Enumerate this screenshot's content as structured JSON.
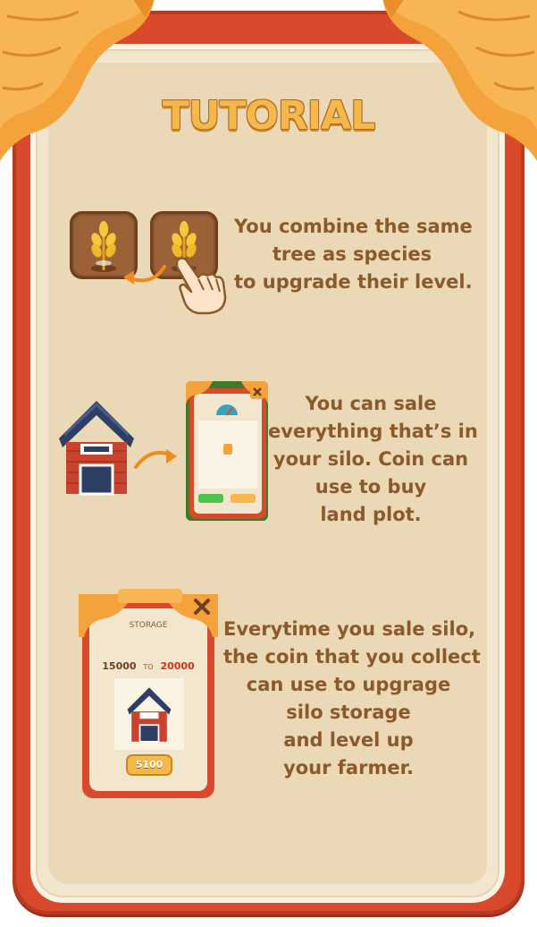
{
  "title": "TUTORIAL",
  "steps": [
    {
      "lines": [
        "You combine the same",
        "tree as species",
        "to upgrade their level."
      ]
    },
    {
      "lines": [
        "You can sale",
        "everything that’s in",
        "your silo. Coin can",
        "use to buy",
        "land plot."
      ]
    },
    {
      "lines": [
        "Everytime you sale silo,",
        "the coin that you collect",
        "can use to upgrage",
        "silo storage",
        "and level up",
        "your farmer."
      ]
    }
  ],
  "storage_card": {
    "title": "STORAGE",
    "current": "15000",
    "to_label": "TO",
    "next": "20000",
    "price": "5100"
  }
}
